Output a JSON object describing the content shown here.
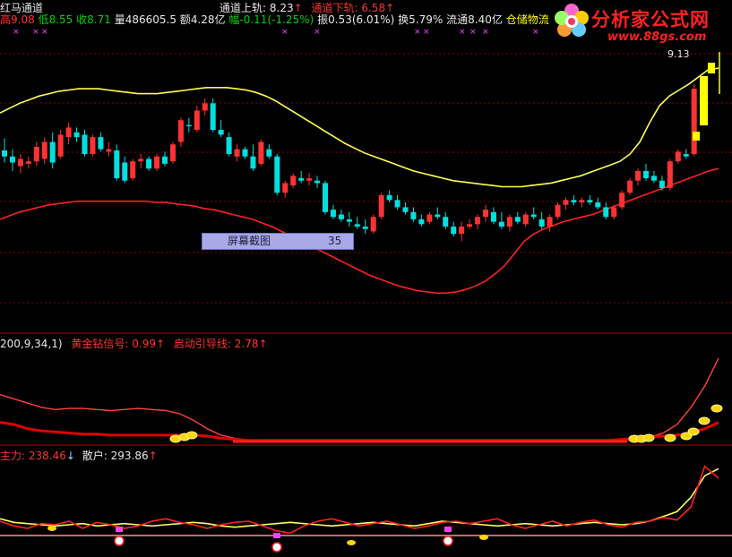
{
  "header": {
    "title": "红马通道",
    "high_label": "高",
    "high_value": "9.08",
    "low_label": "低",
    "low_value": "8.55",
    "close_label": "收",
    "close_value": "8.71",
    "vol_label": "量",
    "vol_value": "486605.5",
    "amount_label": "额",
    "amount_value": "4.28亿",
    "change_label": "幅",
    "change_value": "-0.11(-1.25%)",
    "amp_label": "振",
    "amp_value": "0.53(6.01%)",
    "turnover_label": "换",
    "turnover_value": "5.79%",
    "float_label": "流通",
    "float_value": "8.40亿",
    "sector": "仓储物流",
    "upper_label": "通道上轨:",
    "upper_value": "8.23",
    "lower_label": "通道下轨:",
    "lower_value": "6.58",
    "up_arrow": "↑",
    "price_marker": "9.13"
  },
  "watermark": {
    "text": "分析家公式网",
    "url": "www.88gs.com"
  },
  "screenshot_box": {
    "label": "屏幕截图",
    "value": "35"
  },
  "panel2": {
    "params": "200,9,34,1)",
    "signal_label": "黄金钻信号:",
    "signal_value": "0.99",
    "guide_label": "启动引导线:",
    "guide_value": "2.78",
    "up_arrow": "↑"
  },
  "panel3": {
    "main_label": "主力:",
    "main_value": "238.46",
    "main_arrow": "↓",
    "retail_label": "散户:",
    "retail_value": "293.86",
    "retail_arrow": "↑"
  },
  "colors": {
    "up": "#ff3232",
    "down": "#00e0e0",
    "channel_upper": "#ffff50",
    "channel_lower": "#ff2020",
    "grid": "#8b0000",
    "signal": "#ffd700"
  },
  "candles": [
    {
      "o": 7.55,
      "h": 7.65,
      "l": 7.45,
      "c": 7.5
    },
    {
      "o": 7.5,
      "h": 7.56,
      "l": 7.38,
      "c": 7.45
    },
    {
      "o": 7.42,
      "h": 7.52,
      "l": 7.36,
      "c": 7.48
    },
    {
      "o": 7.44,
      "h": 7.5,
      "l": 7.4,
      "c": 7.46
    },
    {
      "o": 7.46,
      "h": 7.62,
      "l": 7.42,
      "c": 7.58
    },
    {
      "o": 7.48,
      "h": 7.66,
      "l": 7.44,
      "c": 7.62
    },
    {
      "o": 7.62,
      "h": 7.7,
      "l": 7.4,
      "c": 7.45
    },
    {
      "o": 7.5,
      "h": 7.72,
      "l": 7.48,
      "c": 7.68
    },
    {
      "o": 7.66,
      "h": 7.78,
      "l": 7.6,
      "c": 7.74
    },
    {
      "o": 7.7,
      "h": 7.74,
      "l": 7.62,
      "c": 7.66
    },
    {
      "o": 7.68,
      "h": 7.72,
      "l": 7.5,
      "c": 7.52
    },
    {
      "o": 7.52,
      "h": 7.68,
      "l": 7.5,
      "c": 7.66
    },
    {
      "o": 7.66,
      "h": 7.7,
      "l": 7.54,
      "c": 7.56
    },
    {
      "o": 7.54,
      "h": 7.62,
      "l": 7.5,
      "c": 7.56
    },
    {
      "o": 7.55,
      "h": 7.6,
      "l": 7.3,
      "c": 7.32
    },
    {
      "o": 7.45,
      "h": 7.5,
      "l": 7.28,
      "c": 7.3
    },
    {
      "o": 7.32,
      "h": 7.48,
      "l": 7.3,
      "c": 7.46
    },
    {
      "o": 7.46,
      "h": 7.52,
      "l": 7.4,
      "c": 7.48
    },
    {
      "o": 7.48,
      "h": 7.5,
      "l": 7.38,
      "c": 7.4
    },
    {
      "o": 7.4,
      "h": 7.52,
      "l": 7.38,
      "c": 7.5
    },
    {
      "o": 7.5,
      "h": 7.54,
      "l": 7.42,
      "c": 7.44
    },
    {
      "o": 7.46,
      "h": 7.62,
      "l": 7.44,
      "c": 7.6
    },
    {
      "o": 7.62,
      "h": 7.82,
      "l": 7.58,
      "c": 7.8
    },
    {
      "o": 7.76,
      "h": 7.82,
      "l": 7.7,
      "c": 7.75
    },
    {
      "o": 7.72,
      "h": 7.92,
      "l": 7.7,
      "c": 7.88
    },
    {
      "o": 7.88,
      "h": 7.98,
      "l": 7.84,
      "c": 7.94
    },
    {
      "o": 7.94,
      "h": 7.98,
      "l": 7.7,
      "c": 7.72
    },
    {
      "o": 7.72,
      "h": 7.8,
      "l": 7.66,
      "c": 7.68
    },
    {
      "o": 7.66,
      "h": 7.7,
      "l": 7.5,
      "c": 7.52
    },
    {
      "o": 7.5,
      "h": 7.6,
      "l": 7.46,
      "c": 7.56
    },
    {
      "o": 7.56,
      "h": 7.58,
      "l": 7.48,
      "c": 7.5
    },
    {
      "o": 7.5,
      "h": 7.6,
      "l": 7.38,
      "c": 7.4
    },
    {
      "o": 7.44,
      "h": 7.64,
      "l": 7.42,
      "c": 7.62
    },
    {
      "o": 7.56,
      "h": 7.6,
      "l": 7.48,
      "c": 7.5
    },
    {
      "o": 7.5,
      "h": 7.52,
      "l": 7.18,
      "c": 7.2
    },
    {
      "o": 7.2,
      "h": 7.3,
      "l": 7.16,
      "c": 7.28
    },
    {
      "o": 7.26,
      "h": 7.36,
      "l": 7.24,
      "c": 7.34
    },
    {
      "o": 7.32,
      "h": 7.38,
      "l": 7.28,
      "c": 7.3
    },
    {
      "o": 7.3,
      "h": 7.36,
      "l": 7.26,
      "c": 7.32
    },
    {
      "o": 7.3,
      "h": 7.34,
      "l": 7.24,
      "c": 7.28
    },
    {
      "o": 7.28,
      "h": 7.3,
      "l": 7.02,
      "c": 7.04
    },
    {
      "o": 7.06,
      "h": 7.1,
      "l": 6.98,
      "c": 7.0
    },
    {
      "o": 7.02,
      "h": 7.06,
      "l": 6.96,
      "c": 6.98
    },
    {
      "o": 6.98,
      "h": 7.04,
      "l": 6.92,
      "c": 6.96
    },
    {
      "o": 6.94,
      "h": 7.0,
      "l": 6.9,
      "c": 6.92
    },
    {
      "o": 6.92,
      "h": 6.98,
      "l": 6.86,
      "c": 6.9
    },
    {
      "o": 6.88,
      "h": 7.02,
      "l": 6.86,
      "c": 7.0
    },
    {
      "o": 7.0,
      "h": 7.2,
      "l": 6.98,
      "c": 7.18
    },
    {
      "o": 7.18,
      "h": 7.22,
      "l": 7.12,
      "c": 7.14
    },
    {
      "o": 7.14,
      "h": 7.18,
      "l": 7.06,
      "c": 7.08
    },
    {
      "o": 7.08,
      "h": 7.12,
      "l": 7.02,
      "c": 7.04
    },
    {
      "o": 7.04,
      "h": 7.08,
      "l": 6.96,
      "c": 6.98
    },
    {
      "o": 6.98,
      "h": 7.02,
      "l": 6.92,
      "c": 6.94
    },
    {
      "o": 6.96,
      "h": 7.04,
      "l": 6.94,
      "c": 7.02
    },
    {
      "o": 7.02,
      "h": 7.08,
      "l": 6.98,
      "c": 7.0
    },
    {
      "o": 7.0,
      "h": 7.04,
      "l": 6.9,
      "c": 6.92
    },
    {
      "o": 6.92,
      "h": 6.96,
      "l": 6.84,
      "c": 6.86
    },
    {
      "o": 6.86,
      "h": 6.96,
      "l": 6.8,
      "c": 6.92
    },
    {
      "o": 6.92,
      "h": 6.98,
      "l": 6.9,
      "c": 6.94
    },
    {
      "o": 6.94,
      "h": 7.02,
      "l": 6.9,
      "c": 7.0
    },
    {
      "o": 7.0,
      "h": 7.1,
      "l": 6.96,
      "c": 7.06
    },
    {
      "o": 7.04,
      "h": 7.08,
      "l": 6.94,
      "c": 6.96
    },
    {
      "o": 6.96,
      "h": 7.04,
      "l": 6.9,
      "c": 6.92
    },
    {
      "o": 6.92,
      "h": 7.02,
      "l": 6.88,
      "c": 7.0
    },
    {
      "o": 7.0,
      "h": 7.04,
      "l": 6.94,
      "c": 6.96
    },
    {
      "o": 6.94,
      "h": 7.04,
      "l": 6.92,
      "c": 7.02
    },
    {
      "o": 7.02,
      "h": 7.08,
      "l": 6.98,
      "c": 7.0
    },
    {
      "o": 6.98,
      "h": 7.04,
      "l": 6.9,
      "c": 6.92
    },
    {
      "o": 6.92,
      "h": 7.02,
      "l": 6.88,
      "c": 7.0
    },
    {
      "o": 7.0,
      "h": 7.12,
      "l": 6.98,
      "c": 7.1
    },
    {
      "o": 7.1,
      "h": 7.16,
      "l": 7.06,
      "c": 7.14
    },
    {
      "o": 7.14,
      "h": 7.18,
      "l": 7.1,
      "c": 7.12
    },
    {
      "o": 7.12,
      "h": 7.16,
      "l": 7.08,
      "c": 7.14
    },
    {
      "o": 7.14,
      "h": 7.18,
      "l": 7.1,
      "c": 7.12
    },
    {
      "o": 7.12,
      "h": 7.16,
      "l": 7.06,
      "c": 7.08
    },
    {
      "o": 7.08,
      "h": 7.12,
      "l": 6.98,
      "c": 7.0
    },
    {
      "o": 7.0,
      "h": 7.1,
      "l": 6.98,
      "c": 7.08
    },
    {
      "o": 7.08,
      "h": 7.22,
      "l": 7.06,
      "c": 7.2
    },
    {
      "o": 7.2,
      "h": 7.32,
      "l": 7.18,
      "c": 7.3
    },
    {
      "o": 7.3,
      "h": 7.4,
      "l": 7.26,
      "c": 7.38
    },
    {
      "o": 7.38,
      "h": 7.44,
      "l": 7.3,
      "c": 7.32
    },
    {
      "o": 7.34,
      "h": 7.38,
      "l": 7.28,
      "c": 7.3
    },
    {
      "o": 7.3,
      "h": 7.34,
      "l": 7.22,
      "c": 7.24
    },
    {
      "o": 7.24,
      "h": 7.48,
      "l": 7.22,
      "c": 7.46
    },
    {
      "o": 7.46,
      "h": 7.56,
      "l": 7.44,
      "c": 7.54
    },
    {
      "o": 7.52,
      "h": 7.56,
      "l": 7.48,
      "c": 7.5
    },
    {
      "o": 7.52,
      "h": 8.1,
      "l": 7.5,
      "c": 8.06
    }
  ],
  "upper_channel": [
    7.86,
    7.9,
    7.94,
    7.97,
    8.0,
    8.02,
    8.04,
    8.05,
    8.06,
    8.06,
    8.06,
    8.05,
    8.04,
    8.03,
    8.02,
    8.02,
    8.02,
    8.03,
    8.04,
    8.05,
    8.06,
    8.07,
    8.07,
    8.07,
    8.06,
    8.05,
    8.03,
    8.0,
    7.96,
    7.91,
    7.86,
    7.81,
    7.76,
    7.71,
    7.66,
    7.61,
    7.57,
    7.53,
    7.5,
    7.47,
    7.44,
    7.41,
    7.38,
    7.36,
    7.34,
    7.32,
    7.3,
    7.29,
    7.28,
    7.27,
    7.26,
    7.25,
    7.25,
    7.25,
    7.26,
    7.27,
    7.28,
    7.3,
    7.32,
    7.34,
    7.37,
    7.4,
    7.43,
    7.46,
    7.52,
    7.62,
    7.78,
    7.92,
    8.0,
    8.05,
    8.1,
    8.16,
    8.22,
    8.23
  ],
  "lower_channel": [
    6.98,
    7.01,
    7.04,
    7.06,
    7.08,
    7.1,
    7.11,
    7.12,
    7.13,
    7.13,
    7.13,
    7.13,
    7.13,
    7.13,
    7.13,
    7.13,
    7.12,
    7.12,
    7.11,
    7.1,
    7.09,
    7.07,
    7.06,
    7.04,
    7.02,
    7.0,
    6.98,
    6.95,
    6.92,
    6.88,
    6.84,
    6.8,
    6.76,
    6.72,
    6.68,
    6.64,
    6.6,
    6.56,
    6.52,
    6.49,
    6.46,
    6.43,
    6.41,
    6.39,
    6.38,
    6.37,
    6.37,
    6.38,
    6.4,
    6.43,
    6.47,
    6.53,
    6.6,
    6.7,
    6.8,
    6.86,
    6.9,
    6.93,
    6.96,
    6.98,
    7.0,
    7.02,
    7.05,
    7.08,
    7.11,
    7.14,
    7.17,
    7.2,
    7.23,
    7.26,
    7.29,
    7.32,
    7.35,
    7.38,
    7.4
  ],
  "panel2_series": {
    "guide_line": [
      2.2,
      2.0,
      1.8,
      1.6,
      1.5,
      1.55,
      1.55,
      1.5,
      1.45,
      1.5,
      1.55,
      1.5,
      1.45,
      1.3,
      1.0,
      0.6,
      0.3,
      0.15,
      0.05,
      0.05,
      0.05,
      0.05,
      0.05,
      0.05,
      0.05,
      0.05,
      0.05,
      0.05,
      0.05,
      0.05,
      0.05,
      0.05,
      0.05,
      0.05,
      0.05,
      0.05,
      0.05,
      0.05,
      0.05,
      0.05,
      0.05,
      0.05,
      0.05,
      0.05,
      0.05,
      0.05,
      0.1,
      0.2,
      0.4,
      0.8,
      1.6,
      2.6,
      3.9
    ],
    "signal_line": [
      0.9,
      0.8,
      0.6,
      0.5,
      0.45,
      0.4,
      0.35,
      0.35,
      0.3,
      0.3,
      0.3,
      0.3,
      0.3,
      0.3,
      0.3,
      0.25,
      0.15,
      0.1,
      0.05,
      0.05,
      0.05,
      0.05,
      0.05,
      0.05,
      0.05,
      0.05,
      0.05,
      0.05,
      0.05,
      0.05,
      0.05,
      0.05,
      0.05,
      0.05,
      0.05,
      0.05,
      0.05,
      0.05,
      0.05,
      0.05,
      0.05,
      0.05,
      0.05,
      0.05,
      0.05,
      0.1,
      0.15,
      0.2,
      0.25,
      0.3,
      0.4,
      0.6,
      0.9
    ]
  },
  "panel3_series": {
    "main_line": [
      60,
      40,
      30,
      50,
      45,
      60,
      30,
      55,
      45,
      30,
      40,
      60,
      70,
      55,
      45,
      30,
      45,
      55,
      60,
      40,
      20,
      10,
      40,
      60,
      70,
      55,
      40,
      50,
      60,
      45,
      30,
      40,
      55,
      60,
      50,
      60,
      70,
      45,
      30,
      45,
      60,
      40,
      55,
      65,
      45,
      35,
      55,
      60,
      75,
      65,
      120,
      290,
      240
    ],
    "retail_line": [
      70,
      55,
      50,
      45,
      40,
      45,
      50,
      40,
      45,
      50,
      45,
      40,
      45,
      50,
      55,
      50,
      40,
      35,
      40,
      45,
      50,
      55,
      50,
      45,
      40,
      45,
      50,
      55,
      50,
      45,
      40,
      50,
      60,
      55,
      50,
      45,
      40,
      45,
      50,
      45,
      40,
      45,
      50,
      55,
      50,
      45,
      50,
      60,
      80,
      100,
      160,
      250,
      280
    ]
  }
}
